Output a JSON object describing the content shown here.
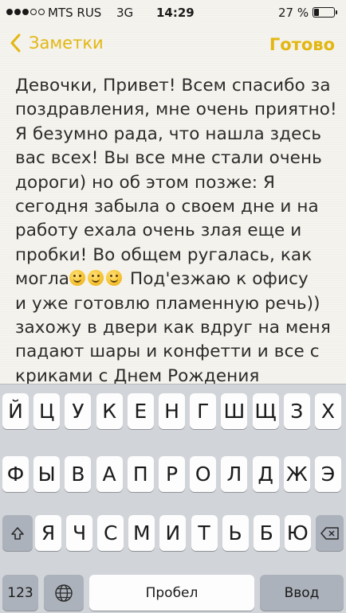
{
  "status_bar": {
    "signal_bars": 3,
    "signal_total": 5,
    "carrier": "MTS RUS",
    "network": "3G",
    "time": "14:29",
    "battery_percent": "27 %",
    "battery_level": 0.27
  },
  "nav": {
    "back_label": "Заметки",
    "done_label": "Готово"
  },
  "note": {
    "lines": [
      "Девочки, Привет! Всем спасибо за",
      "поздравления, мне очень приятно!",
      "Я безумно рада, что нашла здесь",
      "вас всех! Вы все мне стали очень",
      "дороги) но об этом позже: Я",
      "сегодня забыла о своем дне и на",
      "работу ехала очень злая еще и",
      "пробки! Во общем ругалась, как",
      "могла",
      "и уже готовлю пламенную речь))",
      "захожу в двери как вдруг на меня",
      "падают шары и конфетти и все с",
      "криками с Днем Рождения"
    ],
    "emoji_line_suffix": " Под'езжаю к офису",
    "emoji_count": 3
  },
  "keyboard": {
    "row1": [
      "Й",
      "Ц",
      "У",
      "К",
      "Е",
      "Н",
      "Г",
      "Ш",
      "Щ",
      "З",
      "Х"
    ],
    "row2": [
      "Ф",
      "Ы",
      "В",
      "А",
      "П",
      "Р",
      "О",
      "Л",
      "Д",
      "Ж",
      "Э"
    ],
    "row3": [
      "Я",
      "Ч",
      "С",
      "М",
      "И",
      "Т",
      "Ь",
      "Б",
      "Ю"
    ],
    "numbers_label": "123",
    "space_label": "Пробел",
    "return_label": "Ввод",
    "shift_icon": "shift-icon",
    "delete_icon": "delete-icon",
    "globe_icon": "globe-icon"
  },
  "colors": {
    "accent": "#e2b712",
    "paper": "#f5f3ed",
    "keyboard_bg": "#d1d4d9"
  }
}
